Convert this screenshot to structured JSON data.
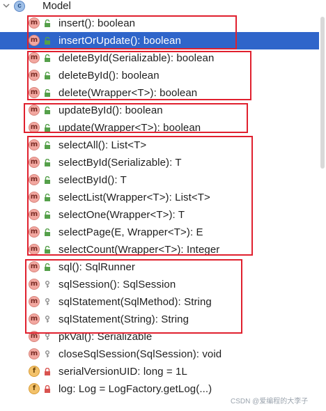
{
  "root": {
    "label": "Model",
    "icon": "class-icon"
  },
  "members": [
    {
      "label": "insert(): boolean",
      "kind": "method",
      "visibility": "public",
      "selected": false
    },
    {
      "label": "insertOrUpdate(): boolean",
      "kind": "method",
      "visibility": "public",
      "selected": true
    },
    {
      "label": "deleteById(Serializable): boolean",
      "kind": "method",
      "visibility": "public",
      "selected": false
    },
    {
      "label": "deleteById(): boolean",
      "kind": "method",
      "visibility": "public",
      "selected": false
    },
    {
      "label": "delete(Wrapper<T>): boolean",
      "kind": "method",
      "visibility": "public",
      "selected": false
    },
    {
      "label": "updateById(): boolean",
      "kind": "method",
      "visibility": "public",
      "selected": false
    },
    {
      "label": "update(Wrapper<T>): boolean",
      "kind": "method",
      "visibility": "public",
      "selected": false
    },
    {
      "label": "selectAll(): List<T>",
      "kind": "method",
      "visibility": "public",
      "selected": false
    },
    {
      "label": "selectById(Serializable): T",
      "kind": "method",
      "visibility": "public",
      "selected": false
    },
    {
      "label": "selectById(): T",
      "kind": "method",
      "visibility": "public",
      "selected": false
    },
    {
      "label": "selectList(Wrapper<T>): List<T>",
      "kind": "method",
      "visibility": "public",
      "selected": false
    },
    {
      "label": "selectOne(Wrapper<T>): T",
      "kind": "method",
      "visibility": "public",
      "selected": false
    },
    {
      "label": "selectPage(E, Wrapper<T>): E",
      "kind": "method",
      "visibility": "public",
      "selected": false
    },
    {
      "label": "selectCount(Wrapper<T>): Integer",
      "kind": "method",
      "visibility": "public",
      "selected": false
    },
    {
      "label": "sql(): SqlRunner",
      "kind": "method",
      "visibility": "public",
      "selected": false
    },
    {
      "label": "sqlSession(): SqlSession",
      "kind": "method",
      "visibility": "protected",
      "selected": false
    },
    {
      "label": "sqlStatement(SqlMethod): String",
      "kind": "method",
      "visibility": "protected",
      "selected": false
    },
    {
      "label": "sqlStatement(String): String",
      "kind": "method",
      "visibility": "protected",
      "selected": false
    },
    {
      "label": "pkVal(): Serializable",
      "kind": "method",
      "visibility": "protected",
      "selected": false
    },
    {
      "label": "closeSqlSession(SqlSession): void",
      "kind": "method",
      "visibility": "protected",
      "selected": false
    },
    {
      "label": "serialVersionUID: long = 1L",
      "kind": "field",
      "visibility": "private",
      "selected": false
    },
    {
      "label": "log: Log = LogFactory.getLog(...)",
      "kind": "field",
      "visibility": "private",
      "selected": false
    }
  ],
  "badges": {
    "method": "m",
    "field": "f",
    "class": "c"
  },
  "colors": {
    "selection": "#2f65ca",
    "highlight_box": "#e0202e",
    "public_lock": "#55a04a",
    "protected_key": "#8a8a8a",
    "private_lock": "#d9534f"
  },
  "watermark": "CSDN @爱编程的大李子"
}
